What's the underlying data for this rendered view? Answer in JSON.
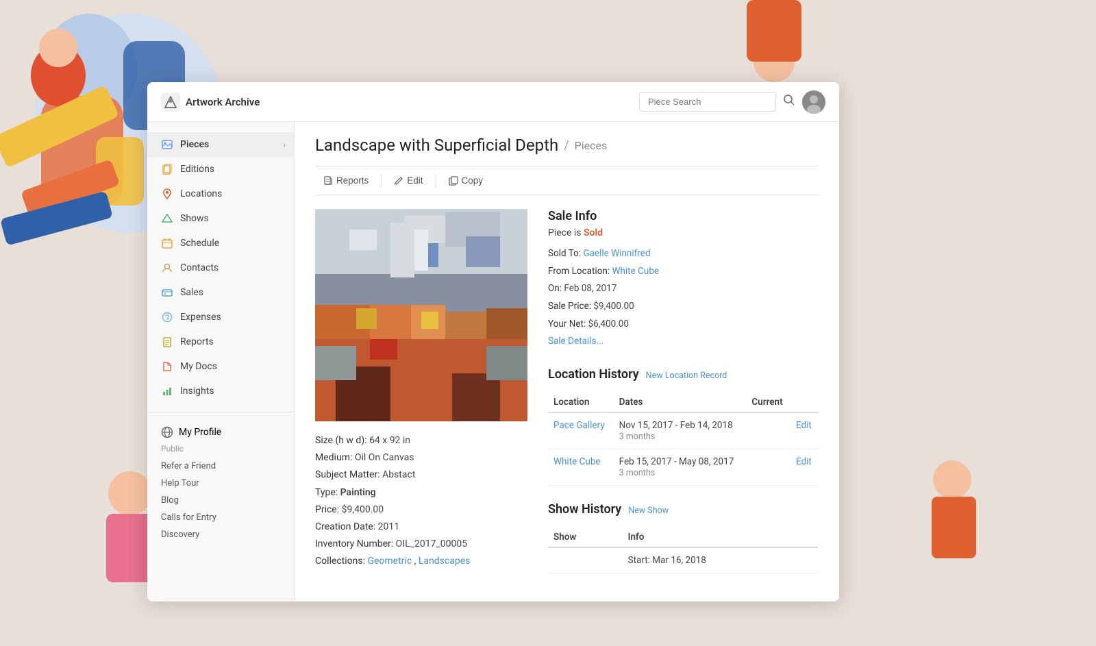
{
  "app": {
    "name": "Artwork Archive",
    "search_placeholder": "Piece Search"
  },
  "sidebar": {
    "items": [
      {
        "id": "pieces",
        "label": "Pieces",
        "icon": "image-icon",
        "has_arrow": true,
        "active": true
      },
      {
        "id": "editions",
        "label": "Editions",
        "icon": "editions-icon",
        "has_arrow": false
      },
      {
        "id": "locations",
        "label": "Locations",
        "icon": "location-icon",
        "has_arrow": false
      },
      {
        "id": "shows",
        "label": "Shows",
        "icon": "shows-icon",
        "has_arrow": false
      },
      {
        "id": "schedule",
        "label": "Schedule",
        "icon": "schedule-icon",
        "has_arrow": false
      },
      {
        "id": "contacts",
        "label": "Contacts",
        "icon": "contacts-icon",
        "has_arrow": false
      },
      {
        "id": "sales",
        "label": "Sales",
        "icon": "sales-icon",
        "has_arrow": false
      },
      {
        "id": "expenses",
        "label": "Expenses",
        "icon": "expenses-icon",
        "has_arrow": false
      },
      {
        "id": "reports",
        "label": "Reports",
        "icon": "reports-icon",
        "has_arrow": false
      },
      {
        "id": "mydocs",
        "label": "My Docs",
        "icon": "mydocs-icon",
        "has_arrow": false
      },
      {
        "id": "insights",
        "label": "Insights",
        "icon": "insights-icon",
        "has_arrow": false
      }
    ],
    "profile": {
      "name": "My Profile",
      "status": "Public"
    },
    "links": [
      "Refer a Friend",
      "Help Tour",
      "Blog",
      "Calls for Entry",
      "Discovery"
    ]
  },
  "page": {
    "title": "Landscape with Superficial Depth",
    "breadcrumb": "Pieces",
    "actions": [
      {
        "id": "reports",
        "label": "Reports",
        "icon": "doc-icon"
      },
      {
        "id": "edit",
        "label": "Edit",
        "icon": "pencil-icon"
      },
      {
        "id": "copy",
        "label": "Copy",
        "icon": "copy-icon"
      }
    ]
  },
  "piece": {
    "size": "64 x 92 in",
    "medium": "Oil On Canvas",
    "subject_matter": "Abstact",
    "type": "Painting",
    "price": "$9,400.00",
    "creation_date": "2011",
    "inventory_number": "OIL_2017_00005",
    "collections": [
      "Geometric",
      "Landscapes"
    ],
    "collection_links": [
      "#",
      "#"
    ]
  },
  "sale_info": {
    "section_title": "Sale Info",
    "status_label": "Piece is",
    "status": "Sold",
    "sold_to_label": "Sold To:",
    "sold_to": "Gaelle Winnifred",
    "from_location_label": "From Location:",
    "from_location": "White Cube",
    "date_label": "On:",
    "date": "Feb 08, 2017",
    "sale_price_label": "Sale Price:",
    "sale_price": "$9,400.00",
    "net_label": "Your Net:",
    "net": "$6,400.00",
    "details_link": "Sale Details..."
  },
  "location_history": {
    "section_title": "Location History",
    "new_record_link": "New Location Record",
    "columns": [
      "Location",
      "Dates",
      "Current"
    ],
    "rows": [
      {
        "location": "Pace Gallery",
        "dates": "Nov 15, 2017 - Feb 14, 2018",
        "duration": "3 months",
        "current": "",
        "edit": "Edit"
      },
      {
        "location": "White Cube",
        "dates": "Feb 15, 2017 - May 08, 2017",
        "duration": "3 months",
        "current": "",
        "edit": "Edit"
      }
    ]
  },
  "show_history": {
    "section_title": "Show History",
    "new_show_link": "New Show",
    "columns": [
      "Show",
      "Info"
    ],
    "rows": [
      {
        "show": "",
        "info": "Start: Mar 16, 2018"
      }
    ]
  }
}
